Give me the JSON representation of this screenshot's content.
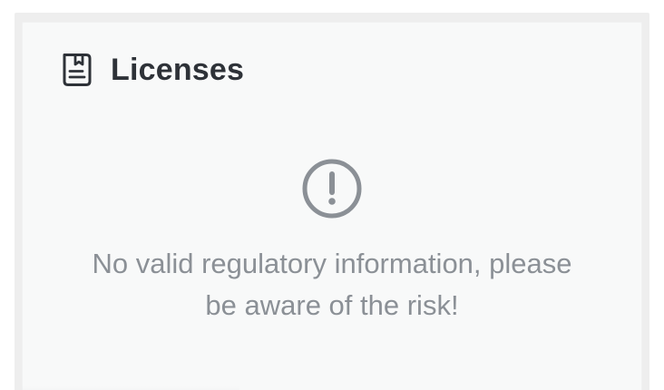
{
  "card": {
    "title": "Licenses",
    "title_icon": "license-document-icon",
    "empty_state": {
      "icon": "warning-circle-icon",
      "message": "No valid regulatory information, please be aware of the risk!"
    }
  },
  "colors": {
    "title_text": "#2e3238",
    "muted_text": "#8b9096",
    "icon_gray": "#8b9096",
    "card_background": "#f8f9f9",
    "frame_background": "#eeeeee"
  }
}
